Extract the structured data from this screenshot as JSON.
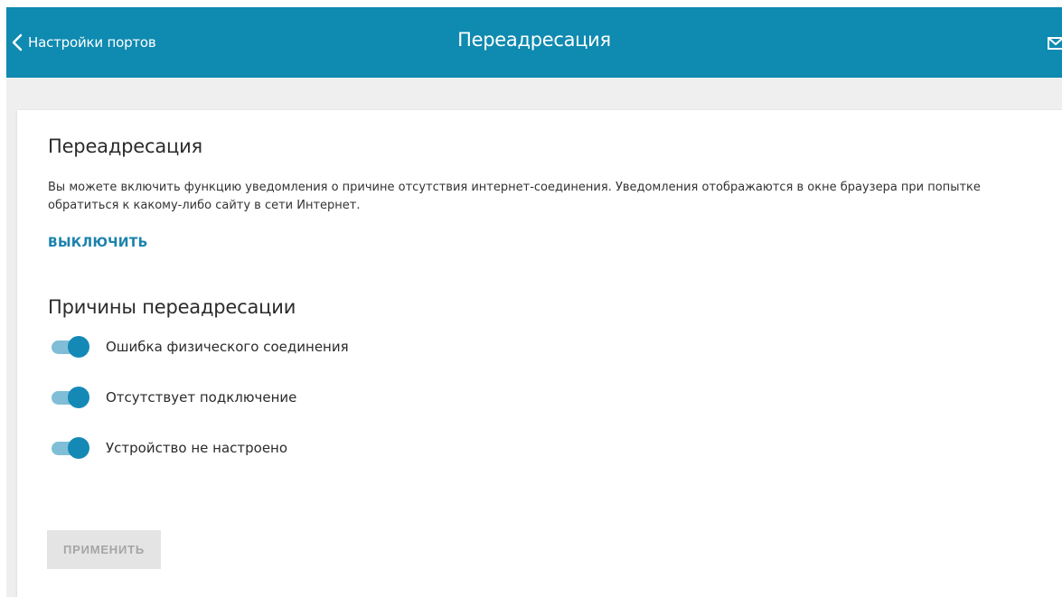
{
  "header": {
    "back_label": "Настройки портов",
    "title": "Переадресация",
    "icons": {
      "back": "chevron-left-icon",
      "mail": "mail-icon"
    }
  },
  "main": {
    "title": "Переадресация",
    "description": "Вы можете включить функцию уведомления о причине отсутствия интернет-соединения. Уведомления отображаются в окне браузера при попытке обратиться к какому-либо сайту в сети Интернет.",
    "disable_link": "ВЫКЛЮЧИТЬ",
    "reasons_title": "Причины переадресации",
    "reasons": [
      {
        "label": "Ошибка физического соединения",
        "enabled": true
      },
      {
        "label": "Отсутствует подключение",
        "enabled": true
      },
      {
        "label": "Устройство не настроено",
        "enabled": true
      }
    ],
    "apply_label": "ПРИМЕНИТЬ",
    "apply_enabled": false
  },
  "colors": {
    "header_bg": "#0f8ab0",
    "accent": "#1489b6",
    "toggle_track": "#7fbed6",
    "page_bg": "#efefef",
    "button_disabled_bg": "#e4e4e4",
    "button_disabled_text": "#a5a5a5"
  }
}
